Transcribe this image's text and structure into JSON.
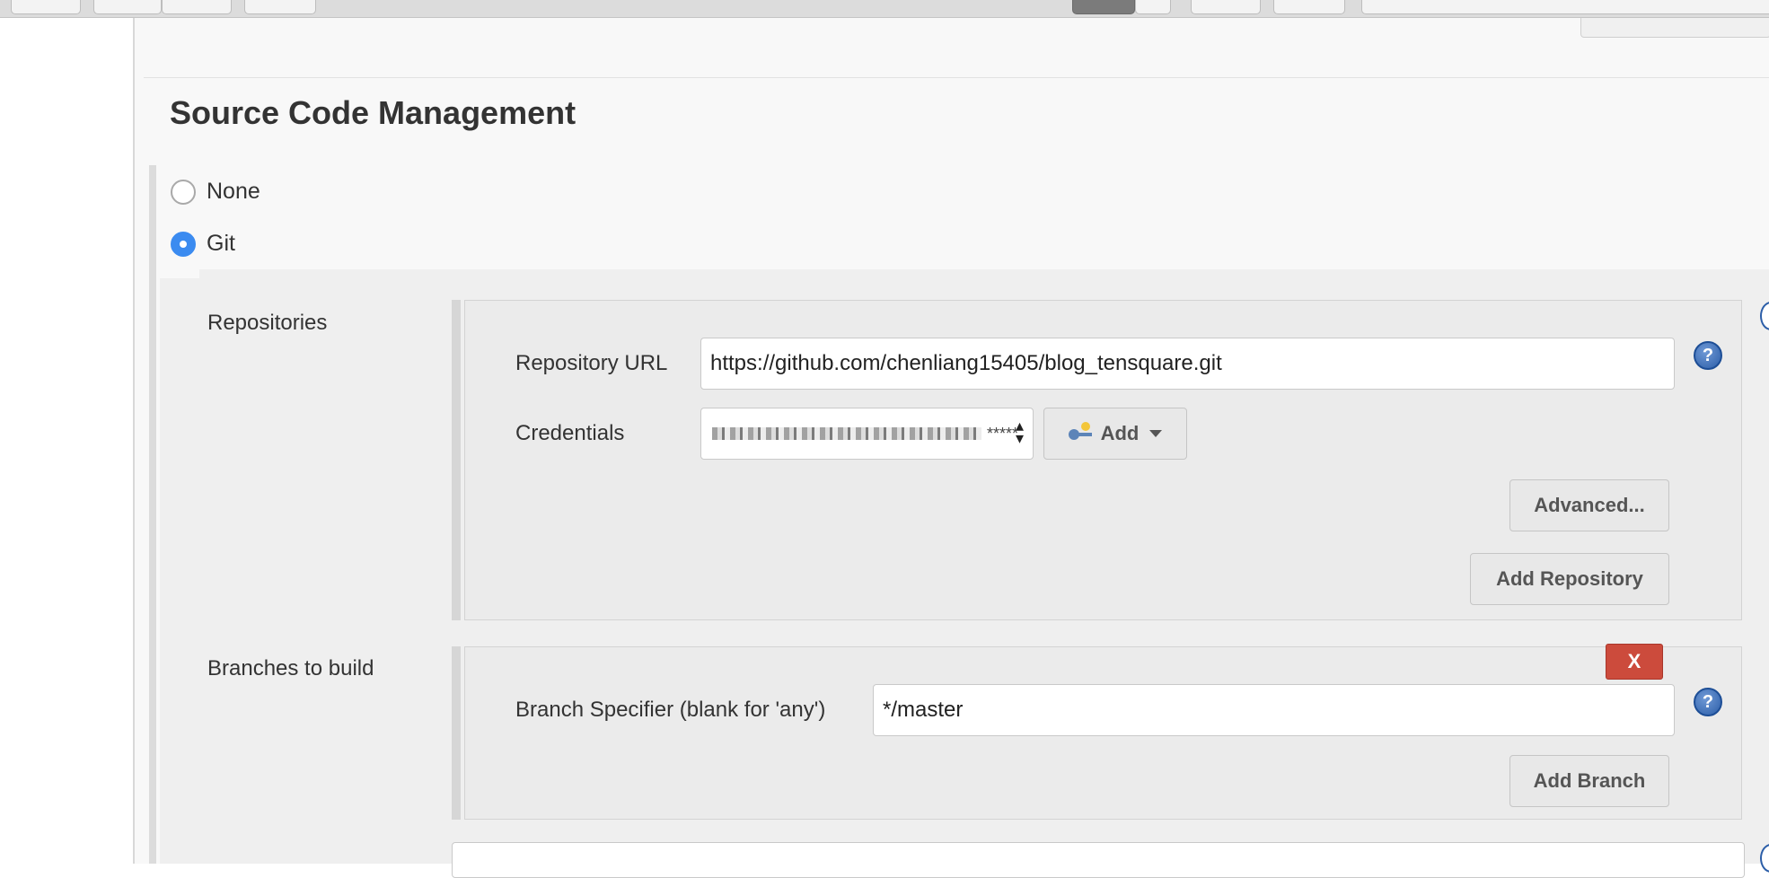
{
  "section": {
    "title": "Source Code Management"
  },
  "scm_options": [
    {
      "label": "None",
      "checked": false
    },
    {
      "label": "Git",
      "checked": true
    }
  ],
  "repositories": {
    "label": "Repositories",
    "url_label": "Repository URL",
    "url_value": "https://github.com/chenliang15405/blog_tensquare.git",
    "credentials_label": "Credentials",
    "credentials_value_suffix": "*****",
    "add_label": "Add",
    "advanced_label": "Advanced...",
    "add_repository_label": "Add Repository"
  },
  "branches": {
    "label": "Branches to build",
    "delete_label": "X",
    "specifier_label": "Branch Specifier (blank for 'any')",
    "specifier_value": "*/master",
    "add_branch_label": "Add Branch"
  },
  "help_label": "?",
  "icons": [
    "radio-icon",
    "key-icon",
    "chevron-down-icon",
    "help-icon",
    "select-arrows-icon"
  ]
}
